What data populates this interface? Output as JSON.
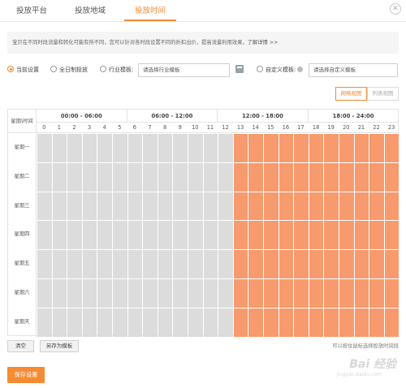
{
  "tabs": [
    {
      "label": "投放平台",
      "active": false
    },
    {
      "label": "投放地域",
      "active": false
    },
    {
      "label": "投放时间",
      "active": true
    }
  ],
  "notice": {
    "text": "宝贝在不同时段流量和转化可能有所不同，您可以针对各时段设置不同的折扣出价，提高流量利用效果，",
    "link": "了解详情 >>"
  },
  "settings": {
    "options": [
      {
        "label": "当前设置",
        "checked": true
      },
      {
        "label": "全日制投放",
        "checked": false
      },
      {
        "label": "行业模板:",
        "checked": false
      },
      {
        "label": "自定义模板:",
        "checked": false
      }
    ],
    "industry_select_placeholder": "请选择行业模板",
    "custom_select_placeholder": "请选择自定义模板"
  },
  "views": {
    "grid_view": "网格视图",
    "list_view": "列表视图",
    "active": "grid_view"
  },
  "schedule": {
    "corner_label": "星期\\时间",
    "ranges": [
      "00:00 - 06:00",
      "06:00 - 12:00",
      "12:00 - 18:00",
      "18:00 - 24:00"
    ],
    "hours": [
      "0",
      "1",
      "2",
      "3",
      "4",
      "5",
      "6",
      "7",
      "8",
      "9",
      "10",
      "11",
      "12",
      "13",
      "14",
      "15",
      "16",
      "17",
      "18",
      "19",
      "20",
      "21",
      "22",
      "23"
    ],
    "days": [
      "星期一",
      "星期二",
      "星期三",
      "星期四",
      "星期五",
      "星期六",
      "星期天"
    ],
    "active_hours": [
      13,
      14,
      15,
      16,
      17,
      18,
      19,
      20,
      21,
      22,
      23
    ]
  },
  "actions": {
    "clear": "清空",
    "save_as_template": "另存为模板",
    "hint": "可以按住鼠标选择投放时间段",
    "save": "保存设置"
  },
  "watermark": {
    "main": "Bai 经验",
    "sub": "jingyan.baidu.com"
  },
  "colors": {
    "accent": "#f58b34",
    "active_cell": "#f79a6e",
    "inactive_cell": "#dcdcdc"
  }
}
